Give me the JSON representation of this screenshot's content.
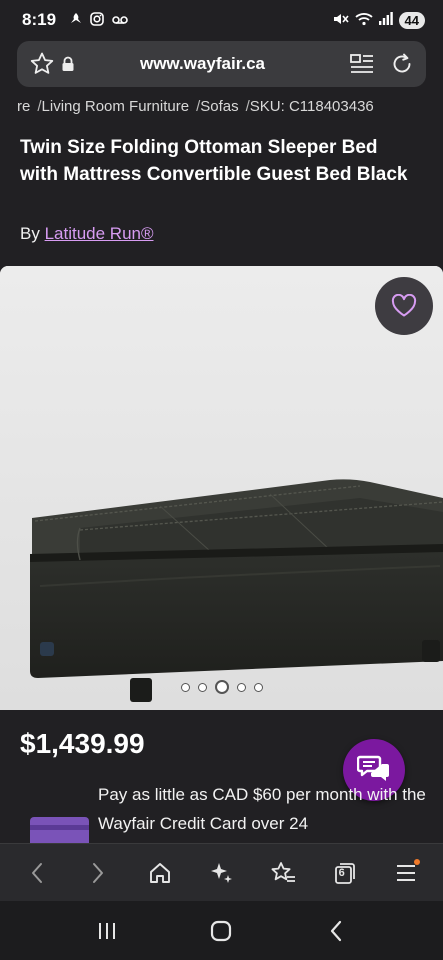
{
  "status_bar": {
    "time": "8:19",
    "battery": "44"
  },
  "url_bar": {
    "url": "www.wayfair.ca"
  },
  "breadcrumb": {
    "items": [
      "re",
      "Living Room Furniture",
      "Sofas",
      "SKU: C118403436"
    ],
    "separator": "/"
  },
  "product": {
    "title": "Twin Size Folding Ottoman Sleeper Bed with Mattress Convertible Guest Bed Black",
    "by_prefix": "By",
    "brand": "Latitude Run®",
    "price": "$1,439.99",
    "financing_text": "Pay as little as CAD $60 per month with the Wayfair Credit Card over 24",
    "image_count": 5,
    "active_image_index": 2
  },
  "toolbar": {
    "tab_count": "6"
  },
  "colors": {
    "background": "#212023",
    "brand_link": "#d79cf2",
    "chat_fab": "#7b189f",
    "notification": "#f07a2a"
  },
  "icons": [
    "wifi-calling-icon",
    "instagram-icon",
    "voicemail-icon",
    "mute-icon",
    "wifi-icon",
    "signal-icon",
    "star-icon",
    "lock-icon",
    "reader-mode-icon",
    "reload-icon",
    "heart-icon",
    "chat-icon",
    "back-icon",
    "forward-icon",
    "home-icon",
    "sparkle-icon",
    "favorites-icon",
    "tabs-icon",
    "menu-icon"
  ]
}
